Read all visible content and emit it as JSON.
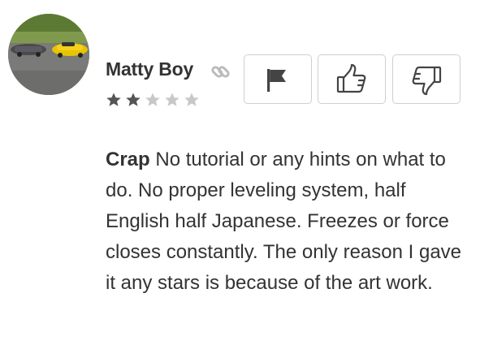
{
  "review": {
    "author": "Matty Boy",
    "rating": 2,
    "max_rating": 5,
    "title": "Crap",
    "body": "No tutorial or any hints on what to do. No proper leveling system, half English half Japanese. Freezes or force closes constantly. The only reason I gave it any stars is because of the art work."
  },
  "colors": {
    "text": "#333333",
    "star_filled": "#555555",
    "star_empty": "#c8c8c8",
    "button_border": "#cfcfcf",
    "icon": "#444444",
    "link_icon": "#bbbbbb"
  },
  "icons": {
    "link": "link-icon",
    "flag": "flag-icon",
    "thumbs_up": "thumbs-up-icon",
    "thumbs_down": "thumbs-down-icon",
    "star": "star-icon"
  }
}
